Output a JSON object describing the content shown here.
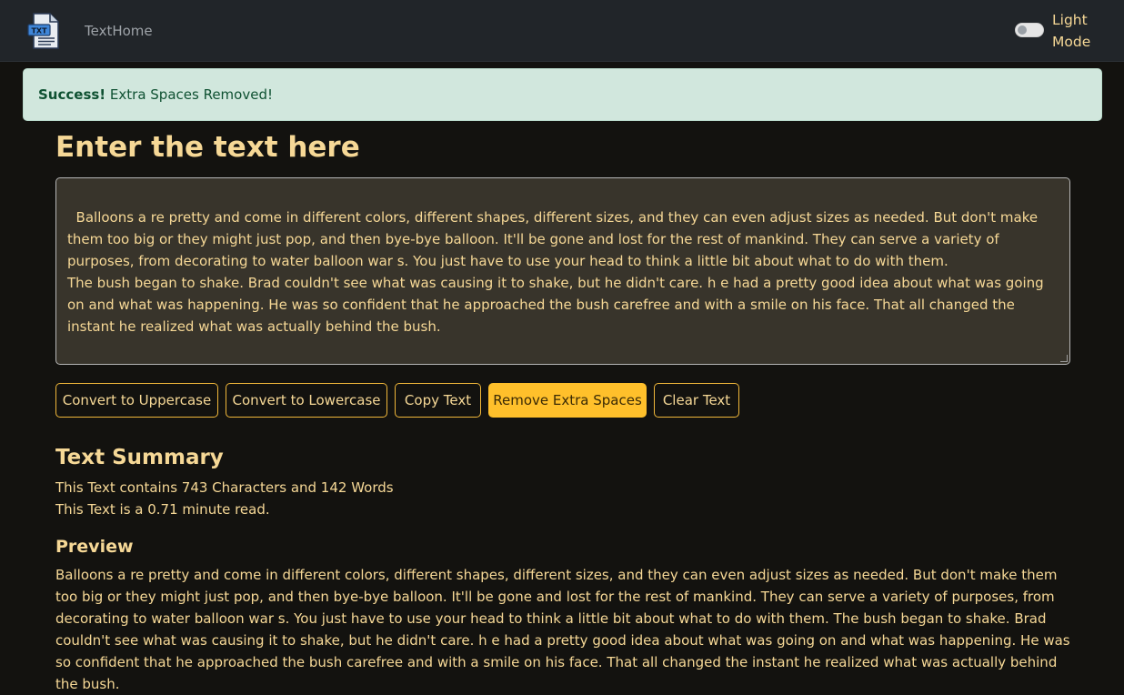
{
  "navbar": {
    "logo_icon": "txt-file-icon",
    "logo_text": "TXT",
    "brand": "TextHome",
    "toggle_label": "Light Mode",
    "toggle_on": false
  },
  "alert": {
    "title": "Success!",
    "message": "Extra Spaces Removed!",
    "color": "#0f5132"
  },
  "main": {
    "heading": "Enter the text here",
    "textarea_value": "Balloons a re pretty and come in different colors, different shapes, different sizes, and they can even adjust sizes as needed. But don't make them too big or they might just pop, and then bye-bye balloon. It'll be gone and lost for the rest of mankind. They can serve a variety of purposes, from decorating to water balloon war s. You just have to use your head to think a little bit about what to do with them.\nThe bush began to shake. Brad couldn't see what was causing it to shake, but he didn't care. h e had a pretty good idea about what was going on and what was happening. He was so confident that he approached the bush carefree and with a smile on his face. That all changed the instant he realized what was actually behind the bush.",
    "buttons": [
      {
        "label": "Convert to Uppercase",
        "active": false
      },
      {
        "label": "Convert to Lowercase",
        "active": false
      },
      {
        "label": "Copy Text",
        "active": false
      },
      {
        "label": "Remove Extra Spaces",
        "active": true
      },
      {
        "label": "Clear Text",
        "active": false
      }
    ]
  },
  "summary": {
    "title": "Text Summary",
    "counts_line": "This Text contains 743 Characters and 142 Words",
    "read_line": "This Text is a 0.71 minute read."
  },
  "preview": {
    "title": "Preview",
    "text": "Balloons a re pretty and come in different colors, different shapes, different sizes, and they can even adjust sizes as needed. But don't make them too big or they might just pop, and then bye-bye balloon. It'll be gone and lost for the rest of mankind. They can serve a variety of purposes, from decorating to water balloon war s. You just have to use your head to think a little bit about what to do with them. The bush began to shake. Brad couldn't see what was causing it to shake, but he didn't care. h e had a pretty good idea about what was going on and what was happening. He was so confident that he approached the bush carefree and with a smile on his face. That all changed the instant he realized what was actually behind the bush."
  },
  "colors": {
    "background": "#13120f",
    "navbar": "#212529",
    "accent_text": "#f6d896",
    "button_border": "#f0b73a",
    "button_active": "#ffc02b",
    "alert_bg": "#d1e7dd"
  }
}
